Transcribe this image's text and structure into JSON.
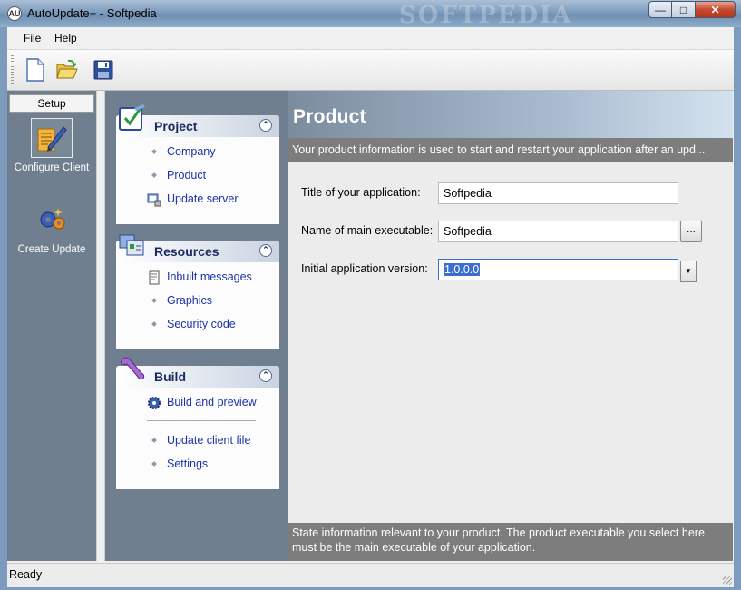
{
  "window": {
    "title": "AutoUpdate+ - Softpedia",
    "watermark": "SOFTPEDIA"
  },
  "menu": {
    "items": [
      "File",
      "Help"
    ]
  },
  "toolbar": {
    "buttons": [
      "new-document-icon",
      "open-folder-icon",
      "save-icon"
    ]
  },
  "left_nav": {
    "header": "Setup",
    "items": [
      {
        "label": "Configure Client",
        "icon": "configure-client-icon",
        "active": true
      },
      {
        "label": "Create Update",
        "icon": "create-update-icon",
        "active": false
      }
    ]
  },
  "task_groups": {
    "project": {
      "title": "Project",
      "items": [
        "Company",
        "Product",
        "Update server"
      ]
    },
    "resources": {
      "title": "Resources",
      "items": [
        "Inbuilt messages",
        "Graphics",
        "Security code"
      ]
    },
    "build": {
      "title": "Build",
      "items": [
        "Build and preview",
        "Update client file",
        "Settings"
      ]
    }
  },
  "main": {
    "title": "Product",
    "description": "Your product information is used to start and restart your application after an upd...",
    "fields": {
      "title_label": "Title of your application:",
      "title_value": "Softpedia",
      "exe_label": "Name of main executable:",
      "exe_value": "Softpedia",
      "browse_label": "...",
      "version_label": "Initial application version:",
      "version_value": "1.0.0.0"
    },
    "footer": "State information relevant to your product. The product executable you select here must be the main executable of your application."
  },
  "status": {
    "text": "Ready"
  },
  "colors": {
    "link": "#1b33a8",
    "group_title": "#1b2a63",
    "selection": "#3a6fd0"
  }
}
